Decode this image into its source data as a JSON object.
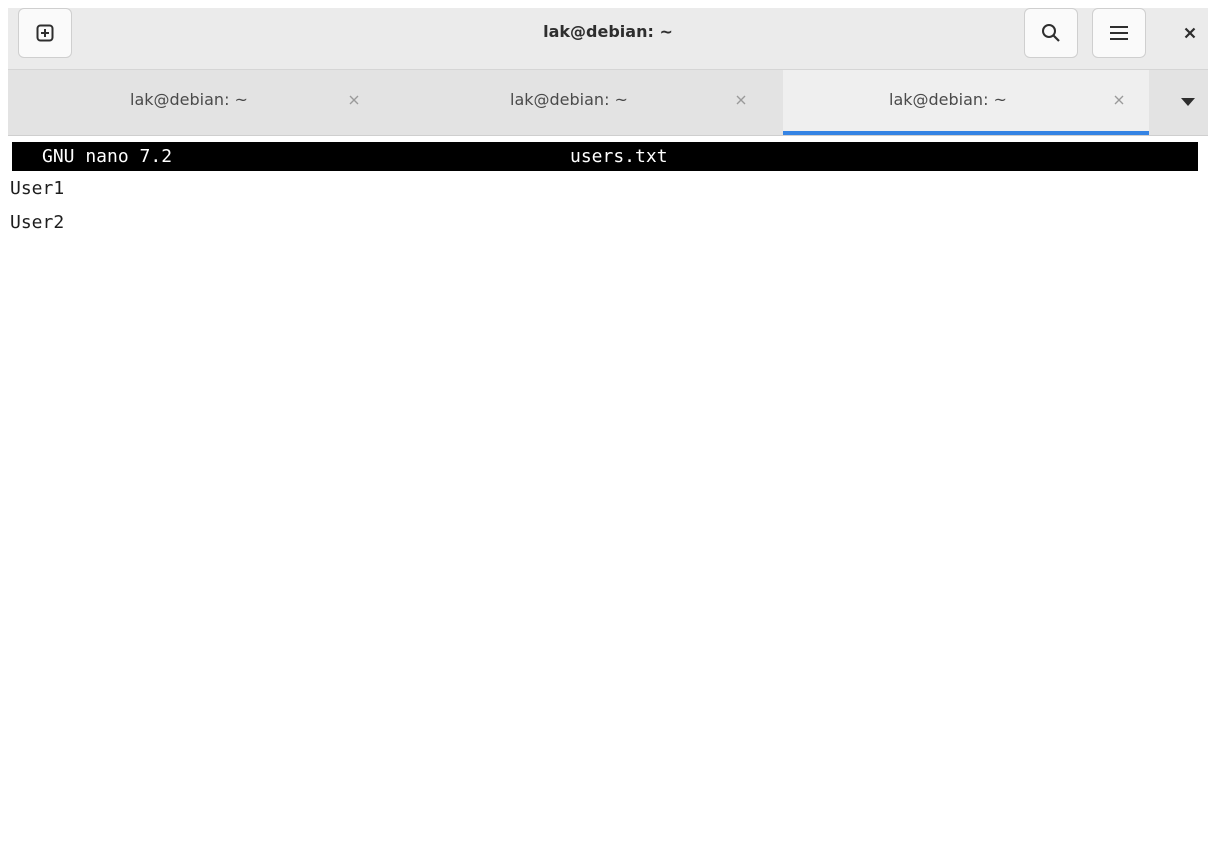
{
  "window": {
    "title": "lak@debian: ~"
  },
  "header": {
    "new_tab_icon": "plus-square-icon",
    "search_icon": "search-icon",
    "menu_icon": "hamburger-menu-icon",
    "close_icon": "close-icon"
  },
  "tabs": [
    {
      "label": "lak@debian: ~",
      "active": false
    },
    {
      "label": "lak@debian: ~",
      "active": false
    },
    {
      "label": "lak@debian: ~",
      "active": true
    }
  ],
  "tab_dropdown_icon": "caret-down-icon",
  "nano": {
    "version": "GNU nano 7.2",
    "filename": "users.txt",
    "lines": [
      "User1",
      "User2"
    ]
  },
  "colors": {
    "accent": "#3584e4",
    "nano_bar_bg": "#000000",
    "nano_bar_fg": "#ffffff"
  }
}
